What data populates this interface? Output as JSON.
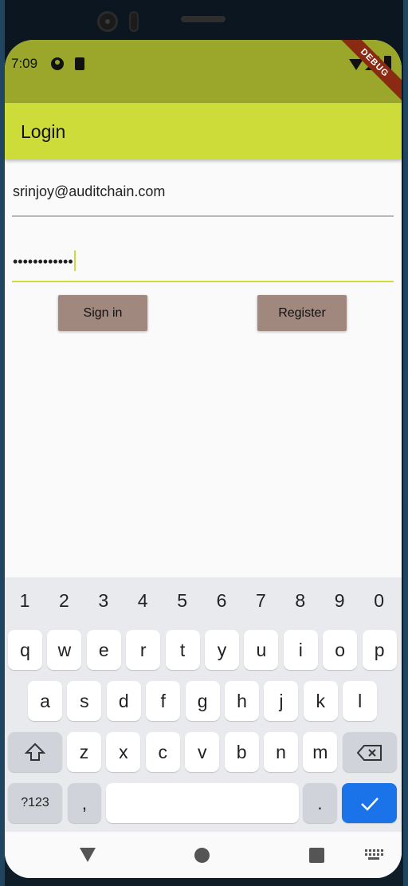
{
  "status_bar": {
    "time": "7:09",
    "debug_label": "DEBUG"
  },
  "app_bar": {
    "title": "Login"
  },
  "form": {
    "email_value": "srinjoy@auditchain.com",
    "password_value": "••••••••••••",
    "signin_label": "Sign in",
    "register_label": "Register"
  },
  "keyboard": {
    "numbers": [
      "1",
      "2",
      "3",
      "4",
      "5",
      "6",
      "7",
      "8",
      "9",
      "0"
    ],
    "row1": [
      "q",
      "w",
      "e",
      "r",
      "t",
      "y",
      "u",
      "i",
      "o",
      "p"
    ],
    "row2": [
      "a",
      "s",
      "d",
      "f",
      "g",
      "h",
      "j",
      "k",
      "l"
    ],
    "row3": [
      "z",
      "x",
      "c",
      "v",
      "b",
      "n",
      "m"
    ],
    "symbols_label": "?123",
    "comma_label": ",",
    "period_label": ".",
    "shift_icon": "shift-icon",
    "backspace_icon": "backspace-icon",
    "enter_icon": "check-icon"
  },
  "nav_bar": {
    "icons": [
      "back-icon",
      "home-icon",
      "recents-icon",
      "keyboard-icon"
    ]
  },
  "colors": {
    "status_bar": "#9aa72b",
    "app_bar": "#cddc39",
    "button": "#a1887f",
    "enter_key": "#1a73e8"
  }
}
